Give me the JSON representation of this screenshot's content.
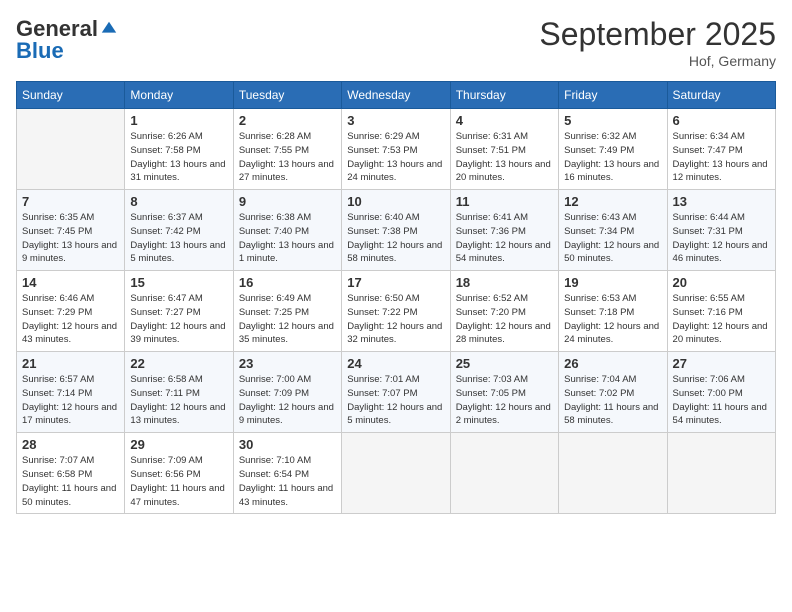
{
  "header": {
    "logo_general": "General",
    "logo_blue": "Blue",
    "month": "September 2025",
    "location": "Hof, Germany"
  },
  "days_of_week": [
    "Sunday",
    "Monday",
    "Tuesday",
    "Wednesday",
    "Thursday",
    "Friday",
    "Saturday"
  ],
  "weeks": [
    [
      {
        "day": "",
        "empty": true
      },
      {
        "day": "1",
        "sunrise": "6:26 AM",
        "sunset": "7:58 PM",
        "daylight": "13 hours and 31 minutes."
      },
      {
        "day": "2",
        "sunrise": "6:28 AM",
        "sunset": "7:55 PM",
        "daylight": "13 hours and 27 minutes."
      },
      {
        "day": "3",
        "sunrise": "6:29 AM",
        "sunset": "7:53 PM",
        "daylight": "13 hours and 24 minutes."
      },
      {
        "day": "4",
        "sunrise": "6:31 AM",
        "sunset": "7:51 PM",
        "daylight": "13 hours and 20 minutes."
      },
      {
        "day": "5",
        "sunrise": "6:32 AM",
        "sunset": "7:49 PM",
        "daylight": "13 hours and 16 minutes."
      },
      {
        "day": "6",
        "sunrise": "6:34 AM",
        "sunset": "7:47 PM",
        "daylight": "13 hours and 12 minutes."
      }
    ],
    [
      {
        "day": "7",
        "sunrise": "6:35 AM",
        "sunset": "7:45 PM",
        "daylight": "13 hours and 9 minutes."
      },
      {
        "day": "8",
        "sunrise": "6:37 AM",
        "sunset": "7:42 PM",
        "daylight": "13 hours and 5 minutes."
      },
      {
        "day": "9",
        "sunrise": "6:38 AM",
        "sunset": "7:40 PM",
        "daylight": "13 hours and 1 minute."
      },
      {
        "day": "10",
        "sunrise": "6:40 AM",
        "sunset": "7:38 PM",
        "daylight": "12 hours and 58 minutes."
      },
      {
        "day": "11",
        "sunrise": "6:41 AM",
        "sunset": "7:36 PM",
        "daylight": "12 hours and 54 minutes."
      },
      {
        "day": "12",
        "sunrise": "6:43 AM",
        "sunset": "7:34 PM",
        "daylight": "12 hours and 50 minutes."
      },
      {
        "day": "13",
        "sunrise": "6:44 AM",
        "sunset": "7:31 PM",
        "daylight": "12 hours and 46 minutes."
      }
    ],
    [
      {
        "day": "14",
        "sunrise": "6:46 AM",
        "sunset": "7:29 PM",
        "daylight": "12 hours and 43 minutes."
      },
      {
        "day": "15",
        "sunrise": "6:47 AM",
        "sunset": "7:27 PM",
        "daylight": "12 hours and 39 minutes."
      },
      {
        "day": "16",
        "sunrise": "6:49 AM",
        "sunset": "7:25 PM",
        "daylight": "12 hours and 35 minutes."
      },
      {
        "day": "17",
        "sunrise": "6:50 AM",
        "sunset": "7:22 PM",
        "daylight": "12 hours and 32 minutes."
      },
      {
        "day": "18",
        "sunrise": "6:52 AM",
        "sunset": "7:20 PM",
        "daylight": "12 hours and 28 minutes."
      },
      {
        "day": "19",
        "sunrise": "6:53 AM",
        "sunset": "7:18 PM",
        "daylight": "12 hours and 24 minutes."
      },
      {
        "day": "20",
        "sunrise": "6:55 AM",
        "sunset": "7:16 PM",
        "daylight": "12 hours and 20 minutes."
      }
    ],
    [
      {
        "day": "21",
        "sunrise": "6:57 AM",
        "sunset": "7:14 PM",
        "daylight": "12 hours and 17 minutes."
      },
      {
        "day": "22",
        "sunrise": "6:58 AM",
        "sunset": "7:11 PM",
        "daylight": "12 hours and 13 minutes."
      },
      {
        "day": "23",
        "sunrise": "7:00 AM",
        "sunset": "7:09 PM",
        "daylight": "12 hours and 9 minutes."
      },
      {
        "day": "24",
        "sunrise": "7:01 AM",
        "sunset": "7:07 PM",
        "daylight": "12 hours and 5 minutes."
      },
      {
        "day": "25",
        "sunrise": "7:03 AM",
        "sunset": "7:05 PM",
        "daylight": "12 hours and 2 minutes."
      },
      {
        "day": "26",
        "sunrise": "7:04 AM",
        "sunset": "7:02 PM",
        "daylight": "11 hours and 58 minutes."
      },
      {
        "day": "27",
        "sunrise": "7:06 AM",
        "sunset": "7:00 PM",
        "daylight": "11 hours and 54 minutes."
      }
    ],
    [
      {
        "day": "28",
        "sunrise": "7:07 AM",
        "sunset": "6:58 PM",
        "daylight": "11 hours and 50 minutes."
      },
      {
        "day": "29",
        "sunrise": "7:09 AM",
        "sunset": "6:56 PM",
        "daylight": "11 hours and 47 minutes."
      },
      {
        "day": "30",
        "sunrise": "7:10 AM",
        "sunset": "6:54 PM",
        "daylight": "11 hours and 43 minutes."
      },
      {
        "day": "",
        "empty": true
      },
      {
        "day": "",
        "empty": true
      },
      {
        "day": "",
        "empty": true
      },
      {
        "day": "",
        "empty": true
      }
    ]
  ]
}
